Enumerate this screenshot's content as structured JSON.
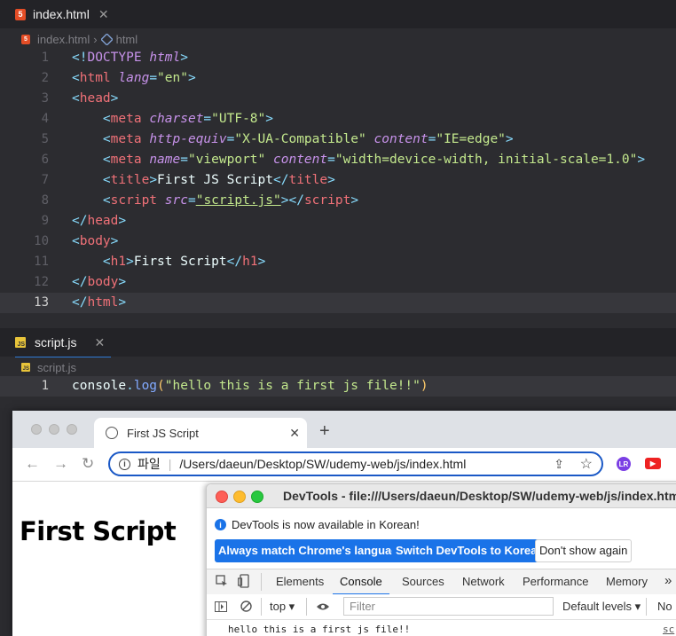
{
  "editor": {
    "html_tab": {
      "label": "index.html",
      "close": "✕"
    },
    "html_breadcrumb": {
      "file": "index.html",
      "sep": "›",
      "symbol": "html"
    },
    "html_lines": [
      {
        "n": "1",
        "segs": [
          [
            "br",
            "<!"
          ],
          [
            "dt",
            "DOCTYPE"
          ],
          [
            "txt",
            " "
          ],
          [
            "attr",
            "html"
          ],
          [
            "br",
            ">"
          ]
        ]
      },
      {
        "n": "2",
        "segs": [
          [
            "br",
            "<"
          ],
          [
            "tag",
            "html"
          ],
          [
            "txt",
            " "
          ],
          [
            "attr",
            "lang"
          ],
          [
            "br",
            "="
          ],
          [
            "str",
            "\"en\""
          ],
          [
            "br",
            ">"
          ]
        ]
      },
      {
        "n": "3",
        "segs": [
          [
            "br",
            "<"
          ],
          [
            "tag",
            "head"
          ],
          [
            "br",
            ">"
          ]
        ]
      },
      {
        "n": "4",
        "segs": [
          [
            "txt",
            "    "
          ],
          [
            "br",
            "<"
          ],
          [
            "tag",
            "meta"
          ],
          [
            "txt",
            " "
          ],
          [
            "attr",
            "charset"
          ],
          [
            "br",
            "="
          ],
          [
            "str",
            "\"UTF-8\""
          ],
          [
            "br",
            ">"
          ]
        ]
      },
      {
        "n": "5",
        "segs": [
          [
            "txt",
            "    "
          ],
          [
            "br",
            "<"
          ],
          [
            "tag",
            "meta"
          ],
          [
            "txt",
            " "
          ],
          [
            "attr",
            "http-equiv"
          ],
          [
            "br",
            "="
          ],
          [
            "str",
            "\"X-UA-Compatible\""
          ],
          [
            "txt",
            " "
          ],
          [
            "attr",
            "content"
          ],
          [
            "br",
            "="
          ],
          [
            "str",
            "\"IE=edge\""
          ],
          [
            "br",
            ">"
          ]
        ]
      },
      {
        "n": "6",
        "segs": [
          [
            "txt",
            "    "
          ],
          [
            "br",
            "<"
          ],
          [
            "tag",
            "meta"
          ],
          [
            "txt",
            " "
          ],
          [
            "attr",
            "name"
          ],
          [
            "br",
            "="
          ],
          [
            "str",
            "\"viewport\""
          ],
          [
            "txt",
            " "
          ],
          [
            "attr",
            "content"
          ],
          [
            "br",
            "="
          ],
          [
            "str",
            "\"width=device-width, initial-scale=1.0\""
          ],
          [
            "br",
            ">"
          ]
        ]
      },
      {
        "n": "7",
        "segs": [
          [
            "txt",
            "    "
          ],
          [
            "br",
            "<"
          ],
          [
            "tag",
            "title"
          ],
          [
            "br",
            ">"
          ],
          [
            "txt",
            "First JS Script"
          ],
          [
            "br",
            "</"
          ],
          [
            "tag",
            "title"
          ],
          [
            "br",
            ">"
          ]
        ]
      },
      {
        "n": "8",
        "segs": [
          [
            "txt",
            "    "
          ],
          [
            "br",
            "<"
          ],
          [
            "tag",
            "script"
          ],
          [
            "txt",
            " "
          ],
          [
            "attr",
            "src"
          ],
          [
            "br",
            "="
          ],
          [
            "str",
            "\"script.js\""
          ],
          [
            "br",
            "></"
          ],
          [
            "tag",
            "script"
          ],
          [
            "br",
            ">"
          ]
        ]
      },
      {
        "n": "9",
        "segs": [
          [
            "br",
            "</"
          ],
          [
            "tag",
            "head"
          ],
          [
            "br",
            ">"
          ]
        ]
      },
      {
        "n": "10",
        "segs": [
          [
            "br",
            "<"
          ],
          [
            "tag",
            "body"
          ],
          [
            "br",
            ">"
          ]
        ]
      },
      {
        "n": "11",
        "segs": [
          [
            "txt",
            "    "
          ],
          [
            "br",
            "<"
          ],
          [
            "tag",
            "h1"
          ],
          [
            "br",
            ">"
          ],
          [
            "txt",
            "First Script"
          ],
          [
            "br",
            "</"
          ],
          [
            "tag",
            "h1"
          ],
          [
            "br",
            ">"
          ]
        ]
      },
      {
        "n": "12",
        "segs": [
          [
            "br",
            "</"
          ],
          [
            "tag",
            "body"
          ],
          [
            "br",
            ">"
          ]
        ]
      },
      {
        "n": "13",
        "segs": [
          [
            "br",
            "</"
          ],
          [
            "tag",
            "html"
          ],
          [
            "br",
            ">"
          ]
        ]
      }
    ],
    "js_tab": {
      "label": "script.js",
      "close": "✕"
    },
    "js_breadcrumb": {
      "file": "script.js"
    },
    "js_lines": [
      {
        "n": "1",
        "segs": [
          [
            "txt",
            "console"
          ],
          [
            "br",
            "."
          ],
          [
            "fn",
            "log"
          ],
          [
            "punc",
            "("
          ],
          [
            "str",
            "\"hello this is a first js file!!\""
          ],
          [
            "punc",
            ")"
          ]
        ]
      }
    ]
  },
  "browser": {
    "tab_title": "First JS Script",
    "tab_close": "✕",
    "new_tab": "+",
    "back": "←",
    "forward": "→",
    "reload": "↻",
    "url_scheme_label": "파일",
    "url": "/Users/daeun/Desktop/SW/udemy-web/js/index.html",
    "share_icon": "⇪",
    "star_icon": "☆",
    "page_heading": "First Script"
  },
  "devtools": {
    "title": "DevTools - file:///Users/daeun/Desktop/SW/udemy-web/js/index.html",
    "notice": "DevTools is now available in Korean!",
    "btn_match": "Always match Chrome's language",
    "btn_switch": "Switch DevTools to Korean",
    "btn_dont": "Don't show again",
    "tabs": [
      "Elements",
      "Console",
      "Sources",
      "Network",
      "Performance",
      "Memory"
    ],
    "more_tabs": "»",
    "context": "top ▾",
    "filter_placeholder": "Filter",
    "levels": "Default levels ▾",
    "issues": "No",
    "log_message": "hello this is a first js file!!",
    "log_source": "sc",
    "prompt": "›"
  }
}
